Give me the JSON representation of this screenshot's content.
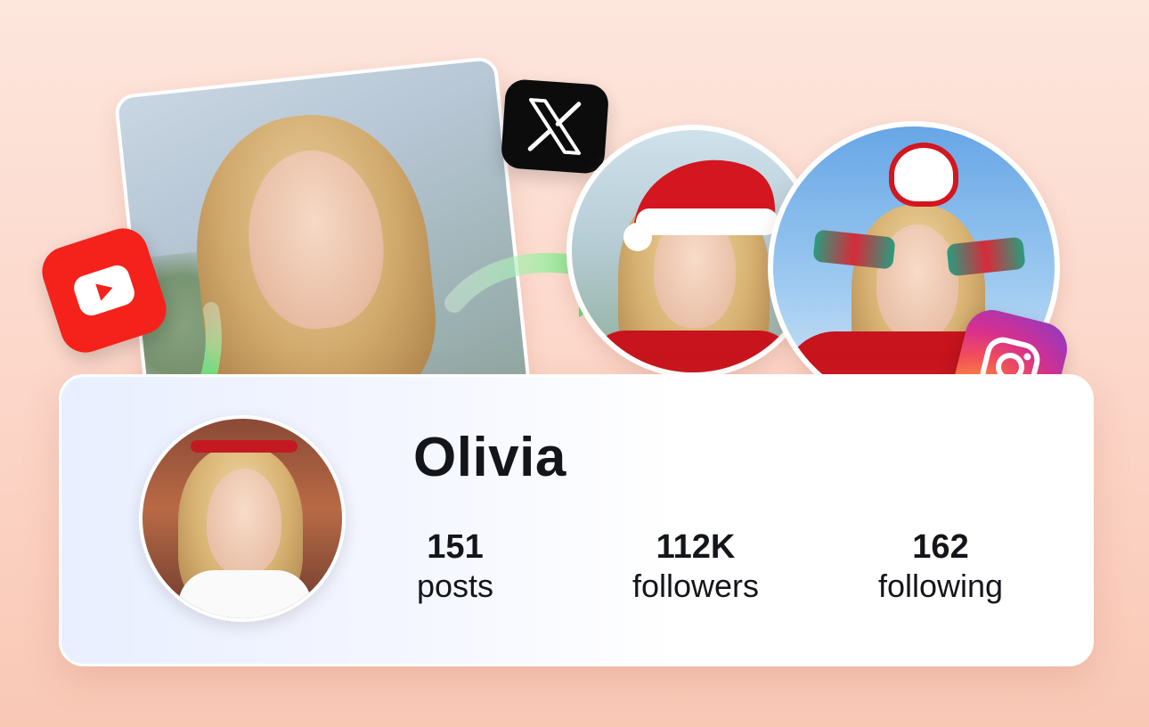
{
  "profile": {
    "name": "Olivia",
    "stats": [
      {
        "value": "151",
        "label": "posts"
      },
      {
        "value": "112K",
        "label": "followers"
      },
      {
        "value": "162",
        "label": "following"
      }
    ]
  },
  "icons": {
    "youtube": "youtube-icon",
    "x": "x-logo-icon",
    "instagram": "instagram-icon",
    "arrow": "green-arrow-icon"
  },
  "colors": {
    "youtube": "#f4221b",
    "x": "#0c0c0c",
    "arrow": "#5ee36b",
    "text": "#14151a",
    "background": "#fcd6c8"
  }
}
